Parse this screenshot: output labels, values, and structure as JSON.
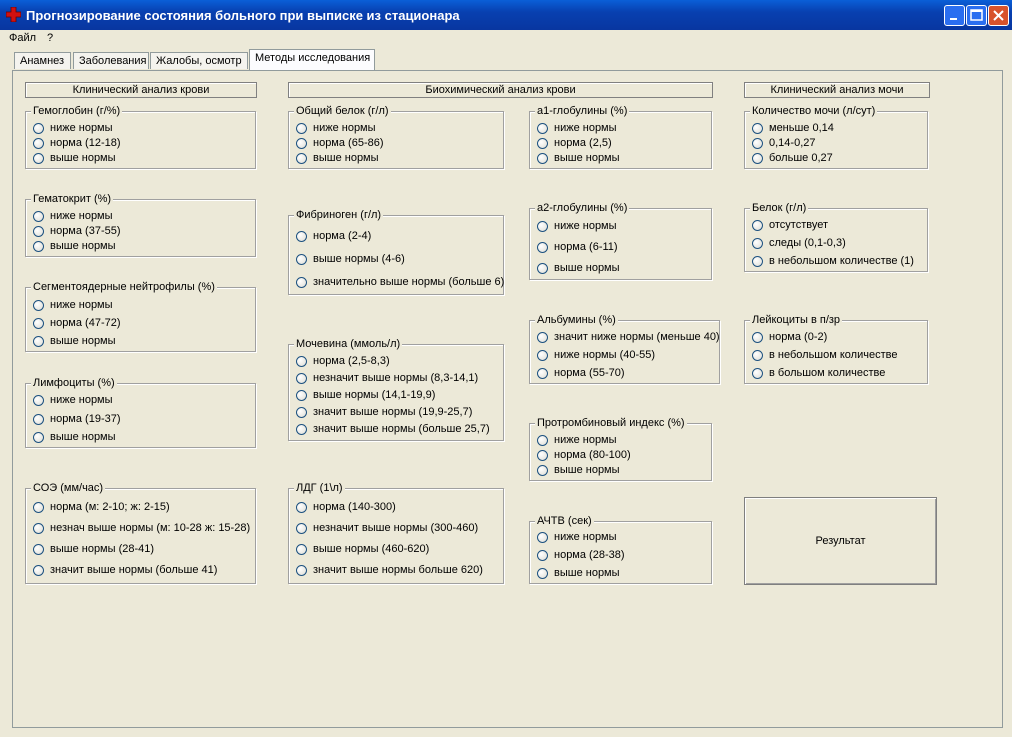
{
  "window": {
    "title": "Прогнозирование состояния больного при выписке из стационара"
  },
  "menu": [
    "Файл",
    "?"
  ],
  "tabs": [
    "Анамнез",
    "Заболевания",
    "Жалобы, осмотр",
    "Методы исследования"
  ],
  "active_tab": "Методы исследования",
  "sections": {
    "blood_clinical": "Клинический анализ крови",
    "biochem": "Биохимический анализ крови",
    "urine": "Клинический анализ мочи"
  },
  "groups": [
    {
      "title": "Гемоглобин (г/%)",
      "options": [
        "ниже нормы",
        "норма (12-18)",
        "выше нормы"
      ]
    },
    {
      "title": "Гематокрит (%)",
      "options": [
        "ниже нормы",
        "норма (37-55)",
        "выше нормы"
      ]
    },
    {
      "title": "Сегментоядерные нейтрофилы (%)",
      "options": [
        "ниже нормы",
        "норма (47-72)",
        "выше нормы"
      ]
    },
    {
      "title": "Лимфоциты (%)",
      "options": [
        "ниже нормы",
        "норма (19-37)",
        "выше нормы"
      ]
    },
    {
      "title": "СОЭ (мм/час)",
      "options": [
        "норма (м: 2-10; ж: 2-15)",
        "незнач выше нормы (м: 10-28 ж: 15-28)",
        "выше нормы (28-41)",
        "значит выше нормы (больше 41)"
      ]
    },
    {
      "title": "Общий белок (г/л)",
      "options": [
        "ниже нормы",
        "норма (65-86)",
        "выше нормы"
      ]
    },
    {
      "title": "Фибриноген (г/л)",
      "options": [
        "норма (2-4)",
        "выше нормы (4-6)",
        "значительно выше нормы (больше 6)"
      ]
    },
    {
      "title": "Мочевина (ммоль/л)",
      "options": [
        "норма (2,5-8,3)",
        "незначит выше нормы (8,3-14,1)",
        "выше нормы (14,1-19,9)",
        "значит выше нормы (19,9-25,7)",
        "значит выше нормы (больше 25,7)"
      ]
    },
    {
      "title": "ЛДГ (1\\л)",
      "options": [
        "норма (140-300)",
        "незначит выше нормы (300-460)",
        "выше нормы (460-620)",
        "значит выше нормы больше 620)"
      ]
    },
    {
      "title": "а1-глобулины (%)",
      "options": [
        "ниже нормы",
        "норма (2,5)",
        "выше нормы"
      ]
    },
    {
      "title": "а2-глобулины (%)",
      "options": [
        "ниже нормы",
        "норма (6-11)",
        "выше нормы"
      ]
    },
    {
      "title": "Альбумины (%)",
      "options": [
        "значит ниже нормы (меньше 40)",
        "ниже нормы (40-55)",
        "норма (55-70)"
      ]
    },
    {
      "title": "Протромбиновый индекс (%)",
      "options": [
        "ниже нормы",
        "норма (80-100)",
        "выше нормы"
      ]
    },
    {
      "title": "АЧТВ (сек)",
      "options": [
        "ниже нормы",
        "норма (28-38)",
        "выше нормы"
      ]
    },
    {
      "title": "Количество мочи (л/сут)",
      "options": [
        "меньше 0,14",
        "0,14-0,27",
        "больше 0,27"
      ]
    },
    {
      "title": "Белок (г/л)",
      "options": [
        "отсутствует",
        "следы (0,1-0,3)",
        "в небольшом количестве (1)"
      ]
    },
    {
      "title": "Лейкоциты в п/зр",
      "options": [
        "норма (0-2)",
        "в небольшом количестве",
        "в большом количестве"
      ]
    }
  ],
  "result_button": "Результат"
}
